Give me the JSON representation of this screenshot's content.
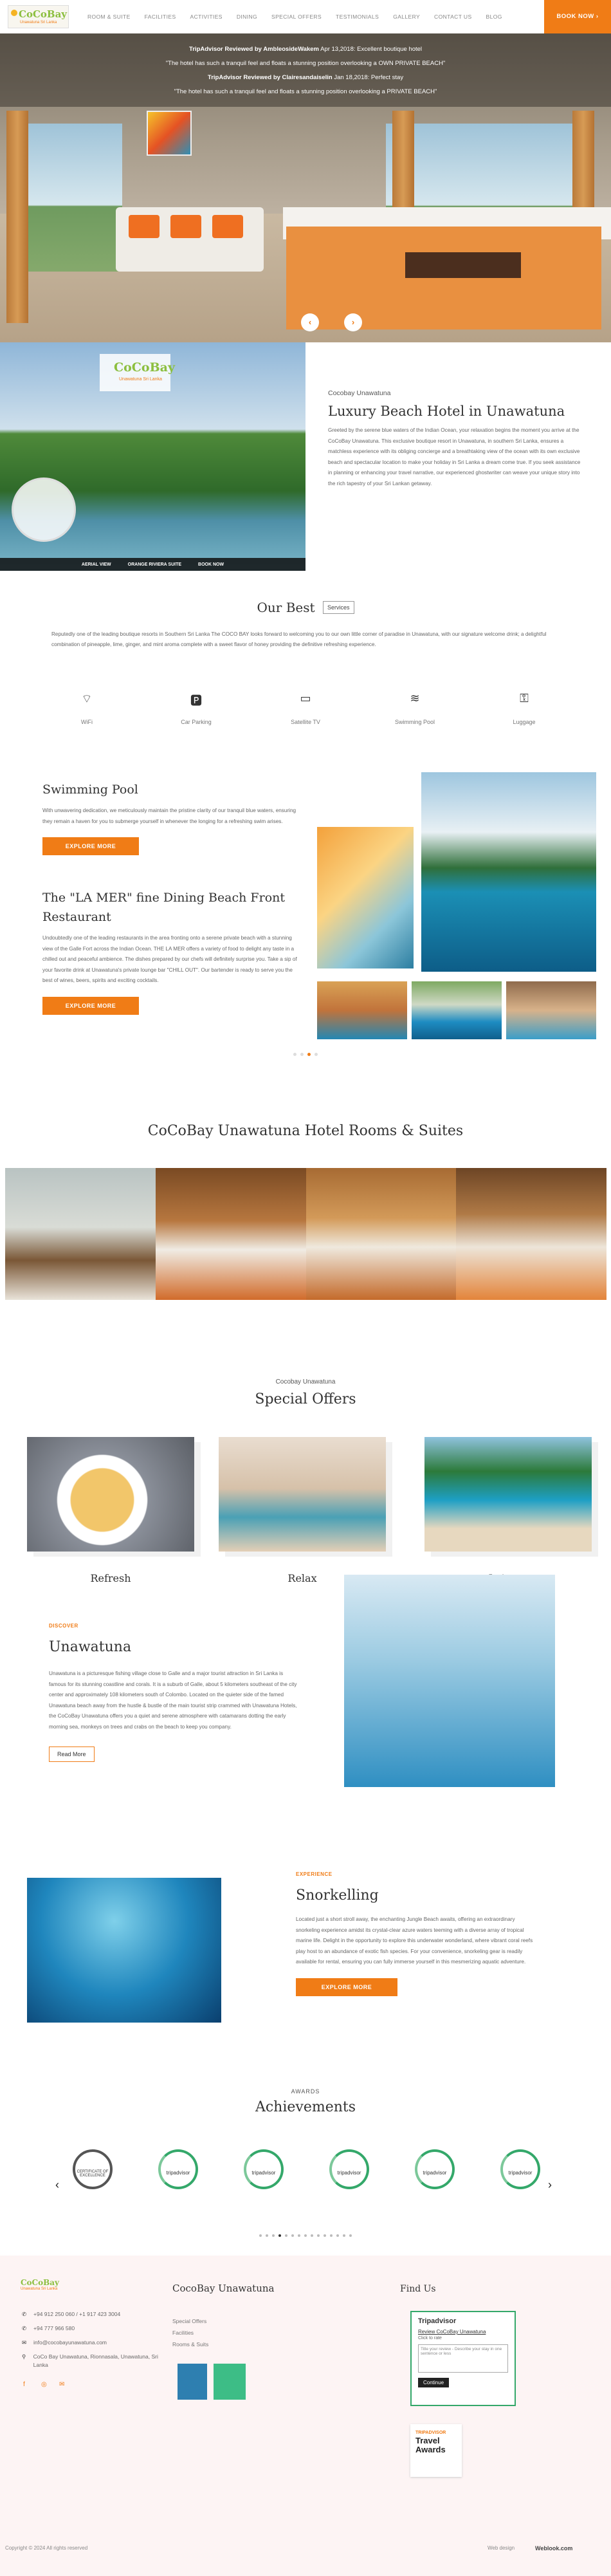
{
  "header": {
    "logo_title": "CoCoBay",
    "logo_sub": "Unawatuna Sri Lanka",
    "nav": [
      "ROOM & SUITE",
      "FACILITIES",
      "ACTIVITIES",
      "DINING",
      "SPECIAL OFFERS",
      "TESTIMONIALS",
      "GALLERY",
      "CONTACT US",
      "BLOG"
    ],
    "book_now": "BOOK NOW  ›"
  },
  "hero": {
    "reviews": [
      {
        "bold": "TripAdvisor Reviewed by AmbleosideWakem",
        "text": " Apr 13,2018: Excellent boutique hotel"
      },
      {
        "bold": "",
        "text": "\"The hotel has such a tranquil feel and floats a stunning position overlooking a  OWN PRIVATE BEACH\""
      },
      {
        "bold": "TripAdvisor Reviewed by Clairesandaiselin",
        "text": " Jan 18,2018: Perfect stay"
      },
      {
        "bold": "",
        "text": "\"The hotel has such a tranquil feel and floats a stunning position overlooking a  PRIVATE BEACH\""
      }
    ],
    "prev": "‹",
    "next": "›"
  },
  "about": {
    "image_logo": "CoCoBay",
    "image_sub": "Unawatuna Sri Lanka",
    "image_bar": [
      "AERIAL VIEW",
      "ORANGE RIVIERA SUITE",
      "BOOK NOW"
    ],
    "eyebrow": "Cocobay Unawatuna",
    "title": "Luxury Beach Hotel in Unawatuna",
    "text": "Greeted by the serene blue waters of the Indian Ocean, your relaxation begins the moment you arrive at the CoCoBay Unawatuna. This exclusive boutique resort in Unawatuna, in southern Sri Lanka, ensures a matchless experience with its obliging concierge and a breathtaking view of the ocean with its own exclusive beach and spectacular location to make your holiday in Sri Lanka a dream come true. If you seek assistance in planning or enhancing your travel narrative, our experienced ghostwriter can weave your unique story into the rich tapestry of your Sri Lankan getaway."
  },
  "best": {
    "title": "Our Best",
    "tag": "Services",
    "text": "Reputedly one of the leading boutique resorts in Southern Sri Lanka The COCO BAY looks forward to welcoming you to our own little corner of paradise in Unawatuna, with our signature welcome drink; a delightful combination of pineapple, lime, ginger, and mint aroma complete with a sweet flavor of honey providing the definitive refreshing experience.",
    "amenities": [
      {
        "icon": "wifi-icon",
        "glyph": "⌔",
        "label": "WiFi"
      },
      {
        "icon": "parking-icon",
        "glyph": "🅿",
        "label": "Car Parking"
      },
      {
        "icon": "tv-icon",
        "glyph": "▭",
        "label": "Satellite TV"
      },
      {
        "icon": "pool-icon",
        "glyph": "≋",
        "label": "Swimming Pool"
      },
      {
        "icon": "luggage-icon",
        "glyph": "⚿",
        "label": "Luggage"
      }
    ]
  },
  "pool": {
    "title": "Swimming Pool",
    "text": "With unwavering dedication, we meticulously maintain the pristine clarity of our tranquil blue waters, ensuring they remain a haven for you to submerge yourself in whenever the longing for a refreshing swim arises.",
    "button": "EXPLORE MORE"
  },
  "dining": {
    "title": "The \"LA MER\" fine Dining Beach Front Restaurant",
    "text": "Undoubtedly one of the leading restaurants in the area fronting onto a serene private beach with a stunning view of the Galle Fort across the Indian Ocean. THE LA MER offers a variety of food to delight any taste in a chilled out and peaceful ambience. The dishes prepared by our chefs will definitely surprise you. Take a sip of your favorite drink at Unawatuna's private lounge bar \"CHILL OUT\". Our bartender is ready to serve you the best of wines, beers, spirits and exciting cocktails.",
    "button": "EXPLORE MORE"
  },
  "rooms": {
    "title": "CoCoBay Unawatuna Hotel Rooms & Suites"
  },
  "offers": {
    "eyebrow": "Cocobay Unawatuna",
    "title": "Special Offers",
    "items": [
      "Refresh",
      "Relax",
      "Leisure"
    ]
  },
  "unawatuna": {
    "eyebrow": "DISCOVER",
    "title": "Unawatuna",
    "text": "Unawatuna is a picturesque fishing village close to Galle and a major tourist attraction in Sri Lanka is famous for its stunning coastline and corals. It is a suburb of Galle, about 5 kilometers southeast of the city center and approximately 108 kilometers south of Colombo. Located on the quieter side of the famed Unawatuna beach away from the hustle & bustle of the main tourist strip crammed with Unawatuna Hotels, the CoCoBay Unawatuna offers you a quiet and serene atmosphere with catamarans dotting the early morning sea, monkeys on trees and crabs on the beach to keep you company.",
    "button": "Read More"
  },
  "snorkel": {
    "eyebrow": "EXPERIENCE",
    "title": "Snorkelling",
    "text": "Located just a short stroll away, the enchanting Jungle Beach awaits, offering an extraordinary snorkeling experience amidst its crystal-clear azure waters teeming with a diverse array of tropical marine life. Delight in the opportunity to explore this underwater wonderland, where vibrant coral reefs play host to an abundance of exotic fish species. For your convenience, snorkeling gear is readily available for rental, ensuring you can fully immerse yourself in this mesmerizing aquatic adventure.",
    "button": "EXPLORE MORE"
  },
  "achievements": {
    "eyebrow": "AWARDS",
    "title": "Achievements",
    "badges": [
      "CERTIFICATE OF EXCELLENCE",
      "tripadvisor",
      "tripadvisor",
      "tripadvisor",
      "tripadvisor",
      "tripadvisor"
    ],
    "prev": "‹",
    "next": "›"
  },
  "footer": {
    "logo_title": "CoCoBay",
    "logo_sub": "Unawatuna Sri Lanka",
    "contacts": [
      {
        "icon": "phone-icon",
        "glyph": "✆",
        "text": "+94 912 250 060 / +1 917 423 3004"
      },
      {
        "icon": "mobile-icon",
        "glyph": "✆",
        "text": "+94 777 966 580"
      },
      {
        "icon": "mail-icon",
        "glyph": "✉",
        "text": "info@cocobayunawatuna.com"
      },
      {
        "icon": "location-icon",
        "glyph": "⚲",
        "text": "CoCo Bay Unawatuna, Rionnasala, Unawatuna, Sri Lanka"
      }
    ],
    "social": [
      "f",
      "◎",
      "✉"
    ],
    "col2_title": "CocoBay Unawatuna",
    "col2_links": [
      "Special Offers",
      "Facilities",
      "Rooms & Suits"
    ],
    "col3_title": "Find Us",
    "ta_brand": "Tripadvisor",
    "ta_title": "Review CoCoBay Unawatuna",
    "ta_sub": "Click to rate",
    "ta_placeholder": "Title your review - Describe your stay in one sentence or less",
    "ta_continue": "Continue",
    "awards_small": "TRIPADVISOR",
    "awards_big": "Travel Awards",
    "copyright": "Copyright © 2024 All rights reserved",
    "webdesign": "Web design",
    "webdesign_brand": "Weblook.com"
  },
  "colors": {
    "accent": "#f07c16",
    "brand_green": "#8cbf3f",
    "footer_bg": "#fdf4f4"
  }
}
